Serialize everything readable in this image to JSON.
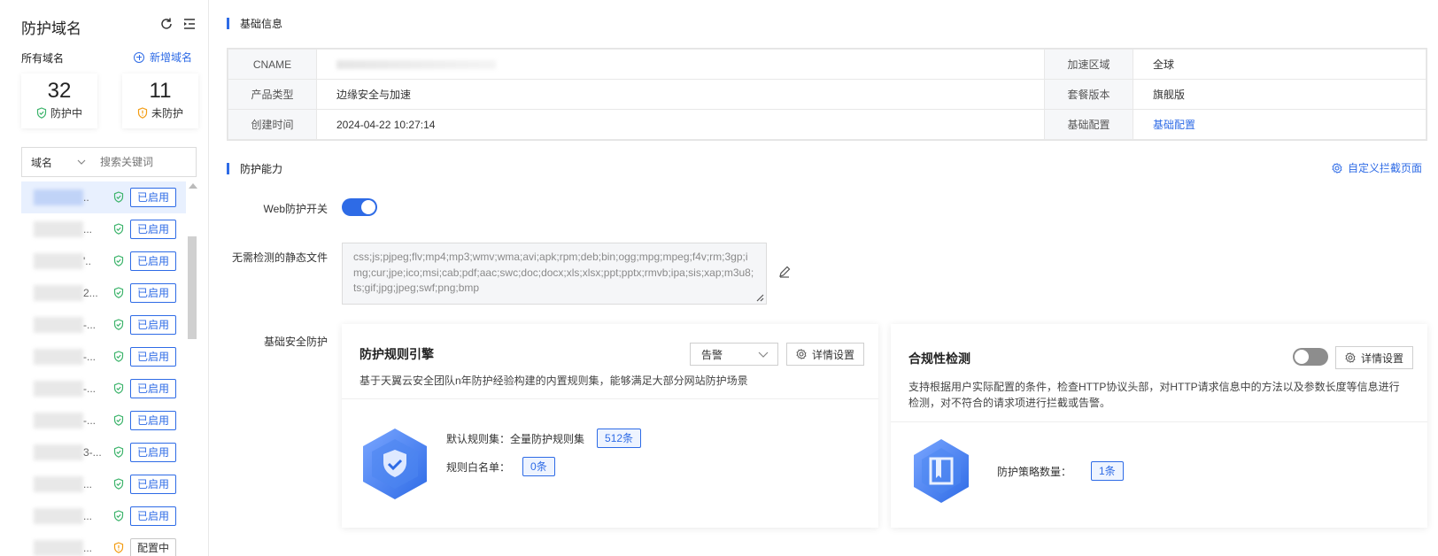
{
  "sidebar": {
    "title": "防护域名",
    "all_domains": "所有域名",
    "add_domain": "新增域名",
    "stats": [
      {
        "num": "32",
        "label": "防护中"
      },
      {
        "num": "11",
        "label": "未防护"
      }
    ],
    "search": {
      "field": "域名",
      "placeholder": "搜索关键词"
    },
    "domains": [
      {
        "dots": "..",
        "status": "已启用",
        "state": "on"
      },
      {
        "dots": "...",
        "status": "已启用",
        "state": "on"
      },
      {
        "dots": "'..",
        "status": "已启用",
        "state": "on"
      },
      {
        "dots": "2...",
        "status": "已启用",
        "state": "on"
      },
      {
        "dots": "-...",
        "status": "已启用",
        "state": "on"
      },
      {
        "dots": "-...",
        "status": "已启用",
        "state": "on"
      },
      {
        "dots": "-...",
        "status": "已启用",
        "state": "on"
      },
      {
        "dots": "-...",
        "status": "已启用",
        "state": "on"
      },
      {
        "dots": "3-...",
        "status": "已启用",
        "state": "on"
      },
      {
        "dots": "...",
        "status": "已启用",
        "state": "on"
      },
      {
        "dots": "...",
        "status": "已启用",
        "state": "on"
      },
      {
        "dots": "...",
        "status": "配置中",
        "state": "cfg"
      }
    ]
  },
  "basic": {
    "title": "基础信息",
    "rows": [
      {
        "k1": "CNAME",
        "v1": "",
        "k2": "加速区域",
        "v2": "全球"
      },
      {
        "k1": "产品类型",
        "v1": "边缘安全与加速",
        "k2": "套餐版本",
        "v2": "旗舰版"
      },
      {
        "k1": "创建时间",
        "v1": "2024-04-22 10:27:14",
        "k2": "基础配置",
        "v2": "基础配置"
      }
    ]
  },
  "protect": {
    "title": "防护能力",
    "custom_page": "自定义拦截页面",
    "web_switch_label": "Web防护开关",
    "static_label": "无需检测的静态文件",
    "static_files": "css;js;pjpeg;flv;mp4;mp3;wmv;wma;avi;apk;rpm;deb;bin;ogg;mpg;mpeg;f4v;rm;3gp;img;cur;jpe;ico;msi;cab;pdf;aac;swc;doc;docx;xls;xlsx;ppt;pptx;rmvb;ipa;sis;xap;m3u8;ts;gif;jpg;jpeg;swf;png;bmp",
    "basic_label": "基础安全防护",
    "engine": {
      "title": "防护规则引擎",
      "mode": "告警",
      "detail_btn": "详情设置",
      "desc": "基于天翼云安全团队n年防护经验构建的内置规则集，能够满足大部分网站防护场景",
      "default_rule_label": "默认规则集：",
      "default_rule_value": "全量防护规则集",
      "default_rule_count": "512条",
      "whitelist_label": "规则白名单：",
      "whitelist_count": "0条"
    },
    "compliance": {
      "title": "合规性检测",
      "detail_btn": "详情设置",
      "desc": "支持根据用户实际配置的条件，检查HTTP协议头部，对HTTP请求信息中的方法以及参数长度等信息进行检测，对不符合的请求项进行拦截或告警。",
      "policy_label": "防护策略数量：",
      "policy_count": "1条"
    }
  },
  "colors": {
    "accent": "#2e6be6",
    "shield_ok": "#3bb36a",
    "shield_warn": "#f39c12"
  }
}
